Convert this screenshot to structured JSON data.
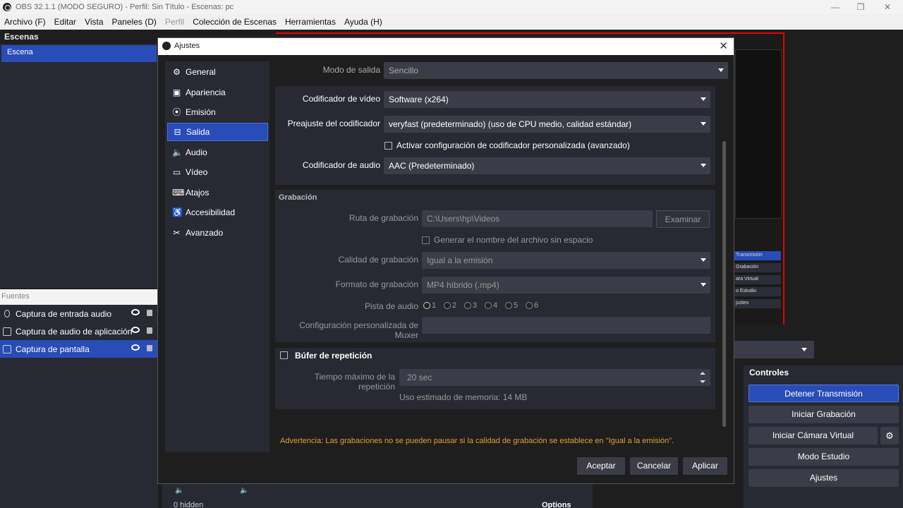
{
  "titlebar": {
    "title": "OBS 32.1.1 (MODO SEGURO) - Perfil: Sin Título - Escenas: pc",
    "minimize": "—",
    "maximize": "❐",
    "close": "✕"
  },
  "menu": [
    {
      "label": "Archivo (F)"
    },
    {
      "label": "Editar"
    },
    {
      "label": "Vista"
    },
    {
      "label": "Paneles (D)"
    },
    {
      "label": "Perfil"
    },
    {
      "label": "Colección de Escenas"
    },
    {
      "label": "Herramientas"
    },
    {
      "label": "Ayuda (H)"
    }
  ],
  "scenes": {
    "title": "Escenas",
    "items": [
      "Escena"
    ]
  },
  "sources": {
    "title": "Fuentes",
    "items": [
      "Captura de entrada audio",
      "Captura de audio de aplicación",
      "Captura de pantalla"
    ]
  },
  "preview_buttons": [
    "Transmisión",
    "Grabación",
    "ara Virtual",
    "o Estudio",
    "justes"
  ],
  "controls": {
    "title": "Controles",
    "buttons": [
      "Detener Transmisión",
      "Iniciar Grabación",
      "Iniciar Cámara Virtual",
      "Modo Estudio",
      "Ajustes"
    ]
  },
  "mixer": {
    "hidden_label": "0 hidden",
    "options_label": "Options"
  },
  "dialog": {
    "title": "Ajustes",
    "nav": [
      {
        "label": "General",
        "icon": "gear-icon",
        "glyph": "⚙"
      },
      {
        "label": "Apariencia",
        "icon": "appearance-icon",
        "glyph": "▣"
      },
      {
        "label": "Emisión",
        "icon": "broadcast-icon",
        "glyph": "⦿"
      },
      {
        "label": "Salida",
        "icon": "output-icon",
        "glyph": "⊟"
      },
      {
        "label": "Audio",
        "icon": "speaker-icon",
        "glyph": "🔈"
      },
      {
        "label": "Vídeo",
        "icon": "monitor-icon",
        "glyph": "▭"
      },
      {
        "label": "Atajos",
        "icon": "keyboard-icon",
        "glyph": "⌨"
      },
      {
        "label": "Accesibilidad",
        "icon": "accessibility-icon",
        "glyph": "♿"
      },
      {
        "label": "Avanzado",
        "icon": "tools-icon",
        "glyph": "✂"
      }
    ],
    "output_mode": {
      "label": "Modo de salida",
      "value": "Sencillo"
    },
    "video_encoder": {
      "label": "Codificador de vídeo",
      "value": "Software (x264)"
    },
    "encoder_preset": {
      "label": "Preajuste del codificador",
      "value": "veryfast (predeterminado) (uso de CPU medio, calidad estándar)"
    },
    "custom_encoder": {
      "label": "Activar configuración de codificador personalizada (avanzado)"
    },
    "audio_encoder": {
      "label": "Codificador de audio",
      "value": "AAC (Predeterminado)"
    },
    "recording": {
      "title": "Grabación",
      "path_label": "Ruta de grabación",
      "path_value": "C:\\Users\\hp\\Videos",
      "browse": "Examinar",
      "no_space_label": "Generar el nombre del archivo sin espacio",
      "quality_label": "Calidad de grabación",
      "quality_value": "Igual a la emisión",
      "format_label": "Formato de grabación",
      "format_value": "MP4 híbrido (.mp4)",
      "tracks_label": "Pista de audio",
      "tracks": [
        "1",
        "2",
        "3",
        "4",
        "5",
        "6"
      ],
      "muxer_label": "Configuración personalizada de Muxer"
    },
    "replay": {
      "title": "Búfer de repetición",
      "max_time_label": "Tiempo máximo de la repetición",
      "max_time_value": "20 sec",
      "memory_label": "Uso estimado de memoria: 14 MB"
    },
    "warning": "Advertencia: Las grabaciones no se pueden pausar si la calidad de grabación se establece en \"Igual a la emisión\".",
    "buttons": {
      "ok": "Aceptar",
      "cancel": "Cancelar",
      "apply": "Aplicar"
    }
  }
}
